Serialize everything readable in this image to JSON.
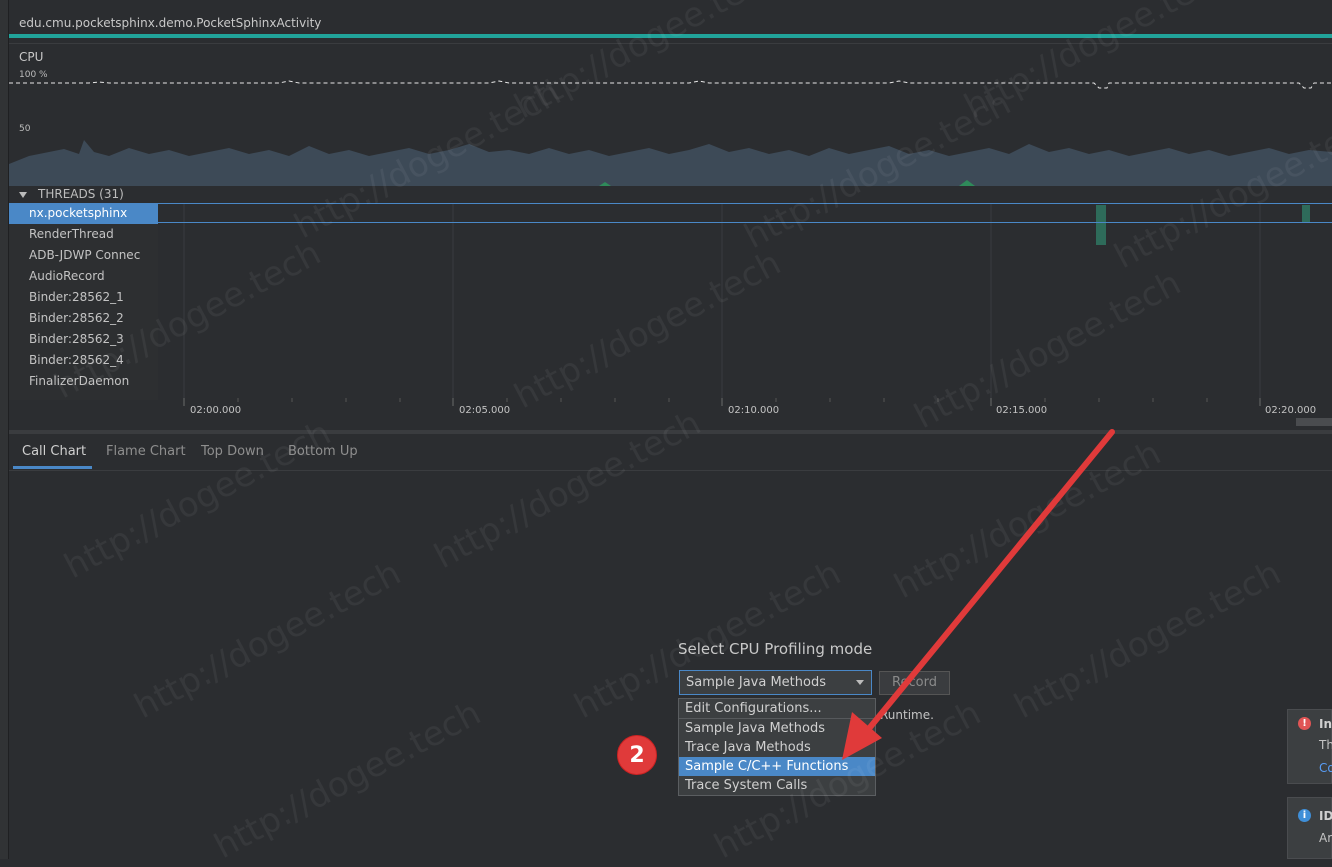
{
  "process": {
    "name": "edu.cmu.pocketsphinx.demo.PocketSphinxActivity",
    "accent_color": "#21a39a"
  },
  "cpu": {
    "label": "CPU",
    "tick_100": "100 %",
    "tick_50": "50"
  },
  "threads": {
    "title": "THREADS (31)",
    "items": [
      {
        "label": "nx.pocketsphinx",
        "selected": true
      },
      {
        "label": "RenderThread"
      },
      {
        "label": "ADB-JDWP Connec"
      },
      {
        "label": "AudioRecord"
      },
      {
        "label": "Binder:28562_1"
      },
      {
        "label": "Binder:28562_2"
      },
      {
        "label": "Binder:28562_3"
      },
      {
        "label": "Binder:28562_4"
      },
      {
        "label": "FinalizerDaemon"
      }
    ]
  },
  "timeline": {
    "ticks": [
      "02:00.000",
      "02:05.000",
      "02:10.000",
      "02:15.000",
      "02:20.000"
    ]
  },
  "tabs": [
    {
      "label": "Call Chart",
      "active": true
    },
    {
      "label": "Flame Chart"
    },
    {
      "label": "Top Down"
    },
    {
      "label": "Bottom Up"
    }
  ],
  "profiling": {
    "title": "Select CPU Profiling mode",
    "selected_value": "Sample Java Methods",
    "record_label": "Record",
    "runtime_text": "Runtime.",
    "options": [
      "Edit Configurations...",
      "Sample Java Methods",
      "Trace Java Methods",
      "Sample C/C++ Functions",
      "Trace System Calls"
    ],
    "highlighted_option": "Sample C/C++ Functions"
  },
  "notifications": [
    {
      "icon": "error-icon",
      "title": "In",
      "body": "Th",
      "link": "Co",
      "color": "#e05555"
    },
    {
      "icon": "info-icon",
      "title": "ID",
      "body": "Ar",
      "color": "#3f8fd8"
    }
  ],
  "annotation": {
    "badge": "2",
    "color": "#e03a3a"
  },
  "watermark": "http://dogee.tech"
}
